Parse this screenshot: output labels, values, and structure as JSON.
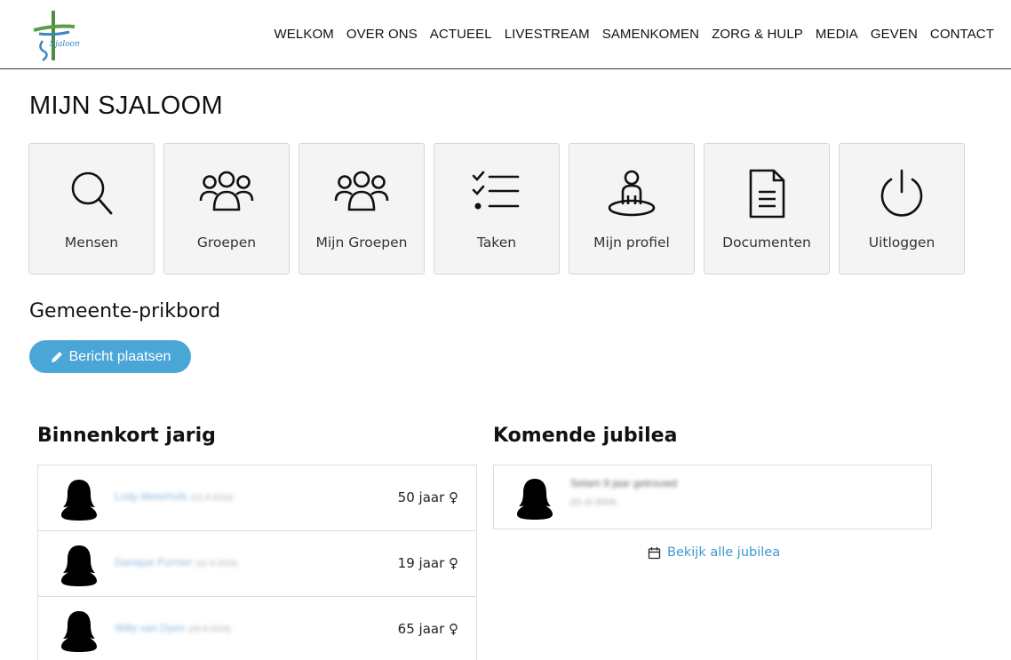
{
  "nav": {
    "items": [
      "WELKOM",
      "OVER ONS",
      "ACTUEEL",
      "LIVESTREAM",
      "SAMENKOMEN",
      "ZORG & HULP",
      "MEDIA",
      "GEVEN",
      "CONTACT"
    ]
  },
  "logo": {
    "text": "Sjaloom"
  },
  "page": {
    "title": "MIJN SJALOOM"
  },
  "tiles": [
    {
      "label": "Mensen",
      "icon": "search-icon"
    },
    {
      "label": "Groepen",
      "icon": "group-icon"
    },
    {
      "label": "Mijn Groepen",
      "icon": "group-icon"
    },
    {
      "label": "Taken",
      "icon": "checklist-icon"
    },
    {
      "label": "Mijn profiel",
      "icon": "profile-icon"
    },
    {
      "label": "Documenten",
      "icon": "document-icon"
    },
    {
      "label": "Uitloggen",
      "icon": "power-icon"
    }
  ],
  "board": {
    "title": "Gemeente-prikbord",
    "post_button": "Bericht plaatsen"
  },
  "birthdays": {
    "title": "Binnenkort jarig",
    "rows": [
      {
        "name": "Lody Meierhofs",
        "date": "(21-9-2024)",
        "age": "50 jaar ♀"
      },
      {
        "name": "Danique Purmer",
        "date": "(21-9-2024)",
        "age": "19 jaar ♀"
      },
      {
        "name": "Willy van Dyen",
        "date": "(29-9-2024)",
        "age": "65 jaar ♀"
      }
    ]
  },
  "jubilees": {
    "title": "Komende jubilea",
    "item": {
      "title": "Selam 9 jaar getrouwd",
      "date": "(21-11-2024)"
    },
    "view_all": "Bekijk alle jubilea"
  },
  "colors": {
    "accent": "#4aa6d6",
    "link": "#3d9ad0",
    "tile_bg": "#f4f4f4"
  }
}
